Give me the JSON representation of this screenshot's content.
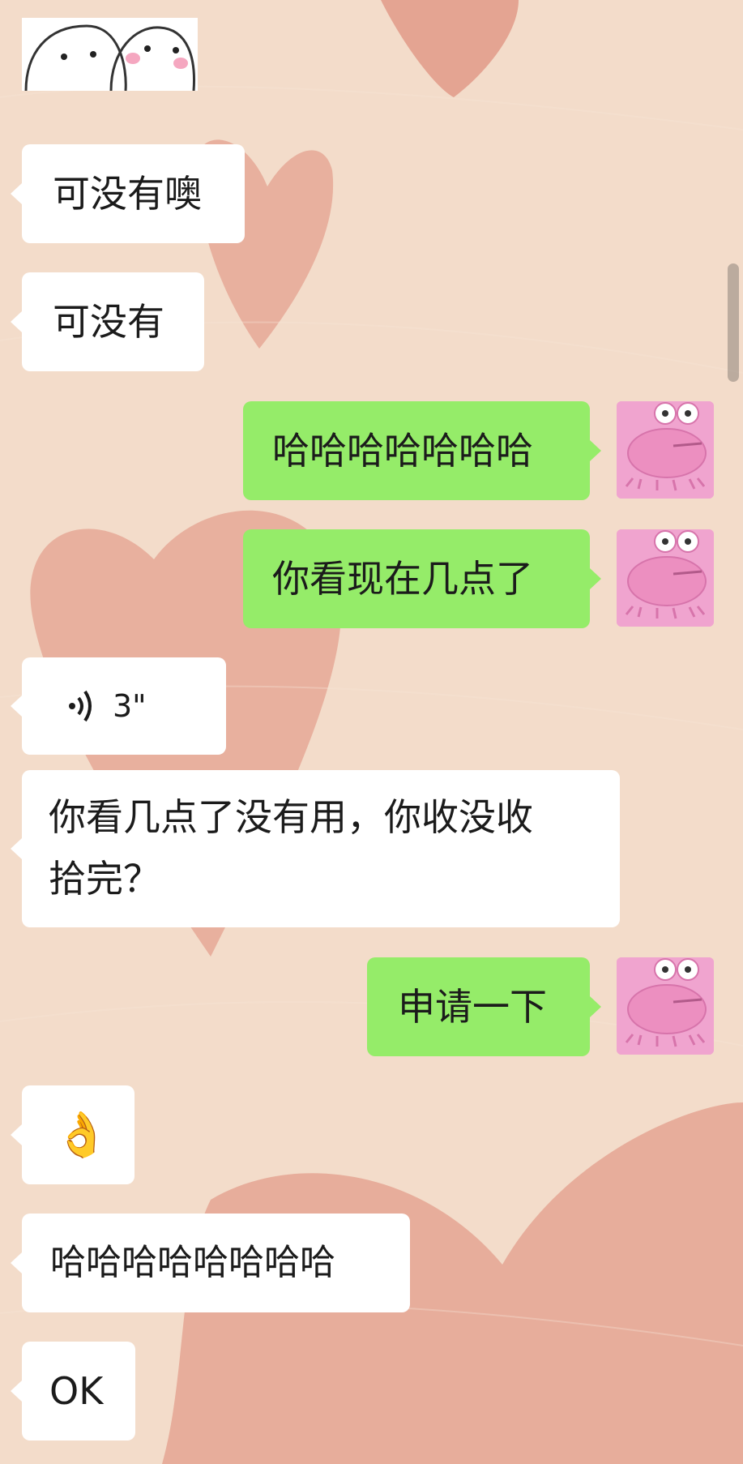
{
  "messages": [
    {
      "side": "in",
      "type": "text",
      "text": "可没有噢"
    },
    {
      "side": "in",
      "type": "text",
      "text": "可没有"
    },
    {
      "side": "out",
      "type": "text",
      "text": "哈哈哈哈哈哈哈"
    },
    {
      "side": "out",
      "type": "text",
      "text": "你看现在几点了"
    },
    {
      "side": "in",
      "type": "voice",
      "duration": "3\""
    },
    {
      "side": "in",
      "type": "text",
      "lines": [
        "你看几点了没有用，你收没收",
        "拾完？"
      ]
    },
    {
      "side": "out",
      "type": "text",
      "text": "申请一下"
    },
    {
      "side": "in",
      "type": "text",
      "text": "👌"
    },
    {
      "side": "in",
      "type": "text",
      "text": "哈哈哈哈哈哈哈哈"
    },
    {
      "side": "in",
      "type": "text",
      "text": "OK"
    }
  ],
  "colors": {
    "incoming_bubble": "#ffffff",
    "outgoing_bubble": "#95ec69",
    "background": "#f3dcca",
    "heart": "#e29a88",
    "avatar": "#f0a4cf"
  },
  "icons": {
    "avatar": "pink-frog-avatar-icon",
    "voice": "voice-wave-icon",
    "sticker": "white-blob-sticker-icon"
  }
}
